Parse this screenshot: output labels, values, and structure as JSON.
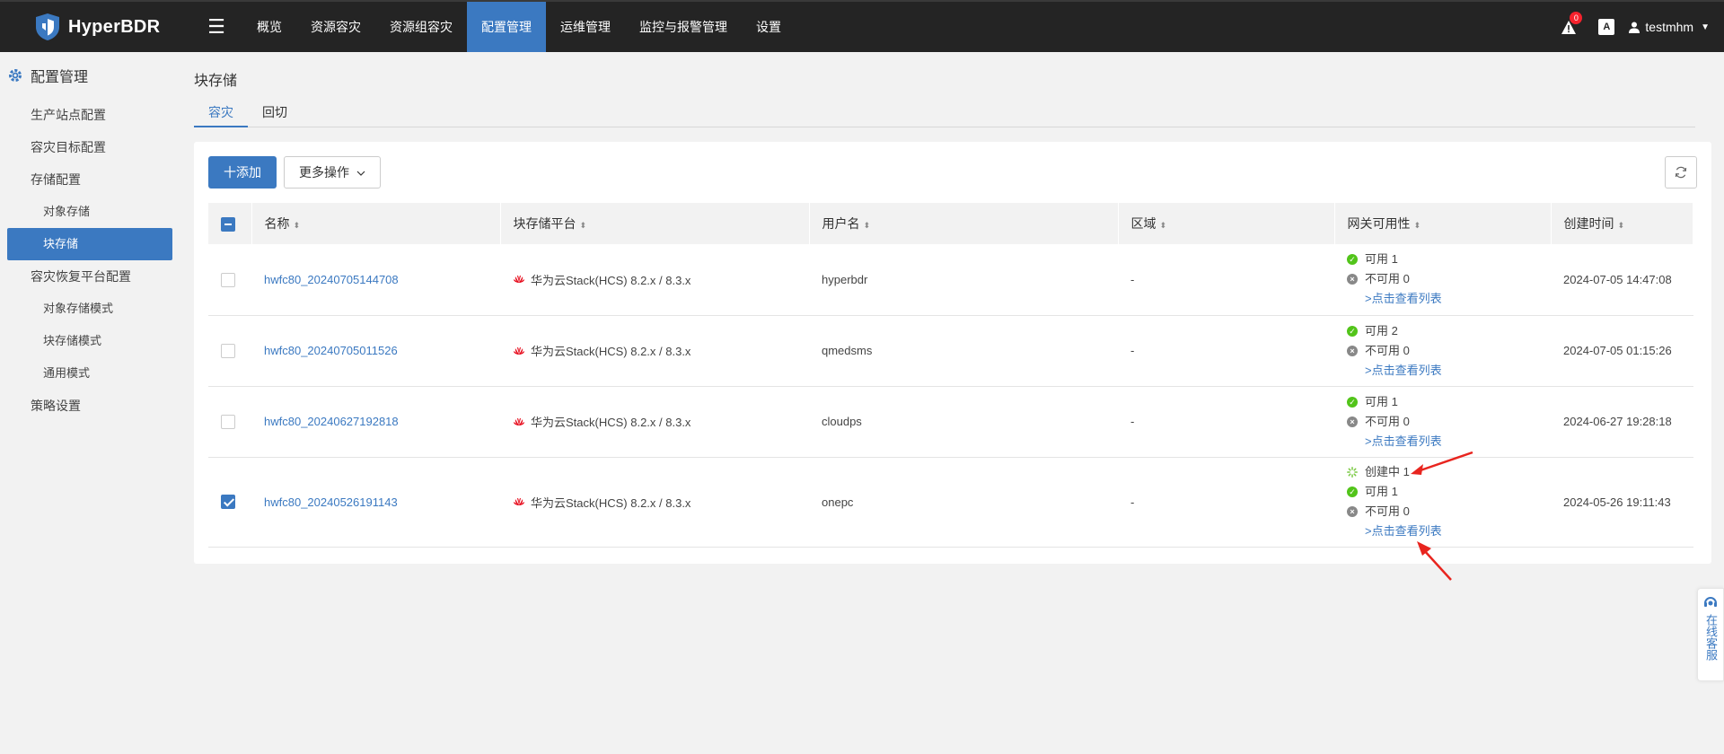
{
  "header": {
    "brand": "HyperBDR",
    "nav": [
      {
        "label": "概览",
        "active": false
      },
      {
        "label": "资源容灾",
        "active": false
      },
      {
        "label": "资源组容灾",
        "active": false
      },
      {
        "label": "配置管理",
        "active": true
      },
      {
        "label": "运维管理",
        "active": false
      },
      {
        "label": "监控与报警管理",
        "active": false
      },
      {
        "label": "设置",
        "active": false
      }
    ],
    "alert_count": "0",
    "lang_label": "A",
    "username": "testmhm"
  },
  "sidebar": {
    "title": "配置管理",
    "items": [
      {
        "label": "生产站点配置",
        "level": 1
      },
      {
        "label": "容灾目标配置",
        "level": 1
      },
      {
        "label": "存储配置",
        "level": 1
      },
      {
        "label": "对象存储",
        "level": 2
      },
      {
        "label": "块存储",
        "level": 2,
        "active": true
      },
      {
        "label": "容灾恢复平台配置",
        "level": 1
      },
      {
        "label": "对象存储模式",
        "level": 2
      },
      {
        "label": "块存储模式",
        "level": 2
      },
      {
        "label": "通用模式",
        "level": 2
      },
      {
        "label": "策略设置",
        "level": 1
      }
    ]
  },
  "page": {
    "title": "块存储",
    "tabs": [
      {
        "label": "容灾",
        "active": true
      },
      {
        "label": "回切",
        "active": false
      }
    ]
  },
  "toolbar": {
    "add_label": "十添加",
    "more_label": "更多操作"
  },
  "table": {
    "columns": [
      "名称",
      "块存储平台",
      "用户名",
      "区域",
      "网关可用性",
      "创建时间"
    ],
    "rows": [
      {
        "name": "hwfc80_20240705144708",
        "platform": "华为云Stack(HCS) 8.2.x / 8.3.x",
        "username": "hyperbdr",
        "region": "-",
        "creating": "",
        "available": "可用 1",
        "unavailable": "不可用 0",
        "list_link": ">点击查看列表",
        "created": "2024-07-05 14:47:08",
        "checked": false
      },
      {
        "name": "hwfc80_20240705011526",
        "platform": "华为云Stack(HCS) 8.2.x / 8.3.x",
        "username": "qmedsms",
        "region": "-",
        "creating": "",
        "available": "可用 2",
        "unavailable": "不可用 0",
        "list_link": ">点击查看列表",
        "created": "2024-07-05 01:15:26",
        "checked": false
      },
      {
        "name": "hwfc80_20240627192818",
        "platform": "华为云Stack(HCS) 8.2.x / 8.3.x",
        "username": "cloudps",
        "region": "-",
        "creating": "",
        "available": "可用 1",
        "unavailable": "不可用 0",
        "list_link": ">点击查看列表",
        "created": "2024-06-27 19:28:18",
        "checked": false
      },
      {
        "name": "hwfc80_20240526191143",
        "platform": "华为云Stack(HCS) 8.2.x / 8.3.x",
        "username": "onepc",
        "region": "-",
        "creating": "创建中 1",
        "available": "可用 1",
        "unavailable": "不可用 0",
        "list_link": ">点击查看列表",
        "created": "2024-05-26 19:11:43",
        "checked": true
      }
    ]
  },
  "service": {
    "label": "在线客服"
  },
  "colors": {
    "accent": "#3b79c1",
    "topbar": "#242424",
    "ok": "#52c41a",
    "annotation": "#e8251f"
  }
}
